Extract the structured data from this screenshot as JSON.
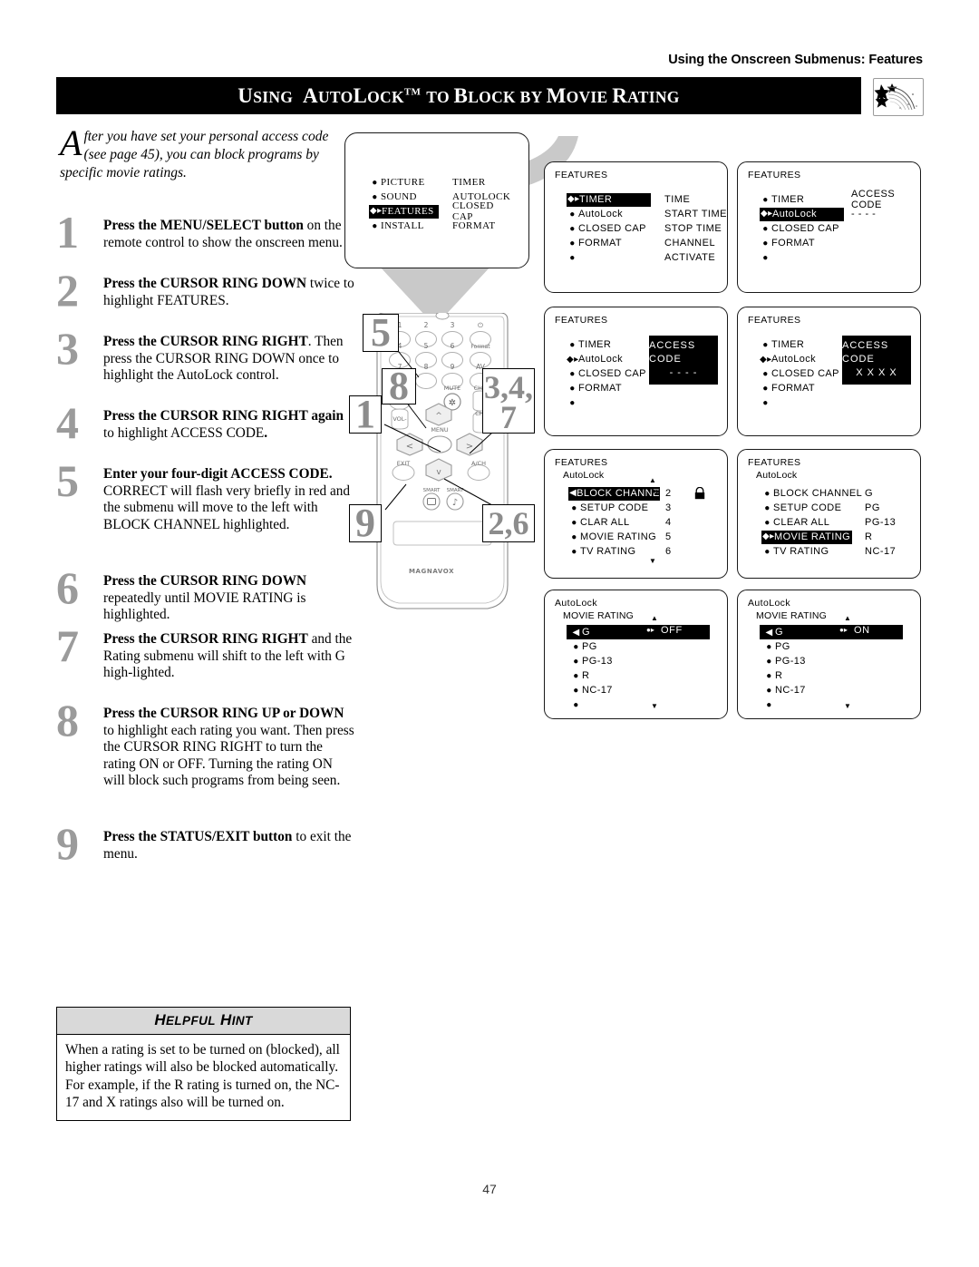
{
  "header": {
    "running_head": "Using the Onscreen Submenus: Features",
    "title_parts": [
      "U",
      "SING",
      "  A",
      "UTO",
      "L",
      "OCK",
      "TM",
      " TO ",
      "B",
      "LOCK BY ",
      "M",
      "OVIE ",
      "R",
      "ATING"
    ],
    "title_plain": "Using AutoLock™ to Block by Movie Rating",
    "logo": "shooting-stars-logo"
  },
  "intro": {
    "dropcap": "A",
    "text": "fter you have set your personal access code (see page 45), you can block programs by specific movie ratings."
  },
  "steps": [
    {
      "num": "1",
      "html": "<b>Press the MENU/SELECT button</b> on the remote control to show the onscreen menu.",
      "plain": "Press the MENU/SELECT button on the remote control to show the onscreen menu."
    },
    {
      "num": "2",
      "html": "<b>Press the CURSOR RING DOWN</b> twice to highlight FEATURES.",
      "plain": "Press the CURSOR RING DOWN twice to highlight FEATURES."
    },
    {
      "num": "3",
      "html": "<b>Press the CURSOR RING RIGHT</b>. Then press the CURSOR RING DOWN once to highlight the AutoLock control.",
      "plain": "Press the CURSOR RING RIGHT. Then press the CURSOR RING DOWN once to highlight the AutoLock control."
    },
    {
      "num": "4",
      "html": "<b>Press the CURSOR RING RIGHT again</b> to highlight ACCESS CODE<b>.</b>",
      "plain": "Press the CURSOR RING RIGHT again to highlight ACCESS CODE."
    },
    {
      "num": "5",
      "html": "<b>Enter your four-digit ACCESS CODE.</b> CORRECT will flash very briefly in red and the submenu will move to the left with BLOCK CHANNEL highlighted.",
      "plain": "Enter your four-digit ACCESS CODE. CORRECT will flash very briefly in red and the submenu will move to the left with BLOCK CHANNEL highlighted."
    },
    {
      "num": "6",
      "html": "<b>Press the CURSOR RING DOWN</b> repeatedly until MOVIE RATING is highlighted.",
      "plain": "Press the CURSOR RING DOWN repeatedly until MOVIE RATING is highlighted."
    },
    {
      "num": "7",
      "html": "<b>Press the CURSOR RING RIGHT</b> and the Rating submenu will shift to the left with G high-lighted.",
      "plain": "Press the CURSOR RING RIGHT and the Rating submenu will shift to the left with G high-lighted."
    },
    {
      "num": "8",
      "html": "<b>Press the CURSOR RING UP or DOWN</b> to highlight each rating you want. Then press the CURSOR RING RIGHT to turn the rating ON or OFF. Turning the rating ON will block such programs from being seen.",
      "plain": "Press the CURSOR RING UP or DOWN to highlight each rating you want. Then press the CURSOR RING RIGHT to turn the rating ON or OFF. Turning the rating ON will block such programs from being seen."
    },
    {
      "num": "9",
      "html": "<b>Press the STATUS/EXIT button</b> to exit the menu.",
      "plain": "Press the STATUS/EXIT button to exit the menu."
    }
  ],
  "hint": {
    "heading": "Helpful Hint",
    "heading_parts": [
      "H",
      "ELPFUL ",
      "H",
      "INT"
    ],
    "body": "When a rating is set to be turned on (blocked), all higher ratings will also be blocked automatically. For example, if the R rating is turned on, the NC-17 and X ratings also will be turned on."
  },
  "tv_screen": {
    "left_items": [
      {
        "label": "PICTURE",
        "highlight": false
      },
      {
        "label": "SOUND",
        "highlight": false
      },
      {
        "label": "FEATURES",
        "highlight": true
      },
      {
        "label": "INSTALL",
        "highlight": false
      }
    ],
    "right_items": [
      "TIMER",
      "AUTOLOCK",
      "CLOSED CAP",
      "FORMAT"
    ]
  },
  "panels": [
    {
      "id": "features-timer",
      "title": "FEATURES",
      "subtitle": "",
      "left_items": [
        {
          "label": "TIMER",
          "highlight": true
        },
        {
          "label": "AutoLock",
          "highlight": false
        },
        {
          "label": "CLOSED CAP",
          "highlight": false
        },
        {
          "label": "FORMAT",
          "highlight": false
        },
        {
          "label": "",
          "highlight": false
        }
      ],
      "right_items": [
        "TIME",
        "START TIME",
        "STOP TIME",
        "CHANNEL",
        "ACTIVATE"
      ],
      "right_boxed": false
    },
    {
      "id": "features-autolock",
      "title": "FEATURES",
      "subtitle": "",
      "left_items": [
        {
          "label": "TIMER",
          "highlight": false
        },
        {
          "label": "AutoLock",
          "highlight": true
        },
        {
          "label": "CLOSED CAP",
          "highlight": false
        },
        {
          "label": "FORMAT",
          "highlight": false
        },
        {
          "label": "",
          "highlight": false
        }
      ],
      "right_items": [
        "ACCESS CODE",
        "- - - -"
      ],
      "right_boxed": false
    },
    {
      "id": "features-access-code-empty",
      "title": "FEATURES",
      "subtitle": "",
      "left_items": [
        {
          "label": "TIMER",
          "highlight": false
        },
        {
          "label": "AutoLock",
          "highlight": false,
          "nav": true
        },
        {
          "label": "CLOSED CAP",
          "highlight": false
        },
        {
          "label": "FORMAT",
          "highlight": false
        },
        {
          "label": "",
          "highlight": false
        }
      ],
      "right_items": [
        "ACCESS CODE",
        "- - - -"
      ],
      "right_boxed": true
    },
    {
      "id": "features-access-code-filled",
      "title": "FEATURES",
      "subtitle": "",
      "left_items": [
        {
          "label": "TIMER",
          "highlight": false
        },
        {
          "label": "AutoLock",
          "highlight": false,
          "nav": true
        },
        {
          "label": "CLOSED CAP",
          "highlight": false
        },
        {
          "label": "FORMAT",
          "highlight": false
        },
        {
          "label": "",
          "highlight": false
        }
      ],
      "right_items": [
        "ACCESS CODE",
        "X X X X"
      ],
      "right_boxed": true
    },
    {
      "id": "autolock-block-channel",
      "title": "FEATURES",
      "subtitle": "AutoLock",
      "left_items": [
        {
          "label": "BLOCK CHANNEL",
          "highlight": true
        },
        {
          "label": "SETUP CODE",
          "highlight": false
        },
        {
          "label": "CLAR ALL",
          "highlight": false
        },
        {
          "label": "MOVIE RATING",
          "highlight": false
        },
        {
          "label": "TV RATING",
          "highlight": false
        }
      ],
      "right_items": [
        "2",
        "3",
        "4",
        "5",
        "6"
      ],
      "lock_icon": "padlock-icon",
      "scroll_up": true,
      "scroll_down": true
    },
    {
      "id": "autolock-movie-rating",
      "title": "FEATURES",
      "subtitle": "AutoLock",
      "left_items": [
        {
          "label": "BLOCK CHANNEL",
          "highlight": false
        },
        {
          "label": "SETUP CODE",
          "highlight": false
        },
        {
          "label": "CLEAR ALL",
          "highlight": false
        },
        {
          "label": "MOVIE RATING",
          "highlight": true
        },
        {
          "label": "TV RATING",
          "highlight": false
        }
      ],
      "right_items": [
        "G",
        "PG",
        "PG-13",
        "R",
        "NC-17"
      ]
    },
    {
      "id": "movie-rating-off",
      "title": "AutoLock",
      "subtitle": "MOVIE RATING",
      "left_items": [
        {
          "label": "G",
          "highlight": true
        },
        {
          "label": "PG",
          "highlight": false
        },
        {
          "label": "PG-13",
          "highlight": false
        },
        {
          "label": "R",
          "highlight": false
        },
        {
          "label": "NC-17",
          "highlight": false
        },
        {
          "label": "",
          "highlight": false
        }
      ],
      "value": "OFF",
      "scroll_up": true,
      "scroll_down": true
    },
    {
      "id": "movie-rating-on",
      "title": "AutoLock",
      "subtitle": "MOVIE RATING",
      "left_items": [
        {
          "label": "G",
          "highlight": true
        },
        {
          "label": "PG",
          "highlight": false
        },
        {
          "label": "PG-13",
          "highlight": false
        },
        {
          "label": "R",
          "highlight": false
        },
        {
          "label": "NC-17",
          "highlight": false
        },
        {
          "label": "",
          "highlight": false
        }
      ],
      "value": "ON",
      "scroll_up": true,
      "scroll_down": true
    }
  ],
  "remote": {
    "brand": "MAGNAVOX",
    "keys_row1": [
      "1",
      "2",
      "3",
      "⏻"
    ],
    "keys_row2": [
      "5",
      "6",
      "Format"
    ],
    "keys_row3": [
      "8",
      "9",
      "AV"
    ],
    "keys_row4": [
      "0",
      "MUTE",
      "CH+"
    ],
    "label_vol": "VOL-",
    "label_chdown": "CH-",
    "label_menu": "MENU",
    "label_exit": "EXIT",
    "label_ach": "A/CH",
    "label_smart_picture": "SMART",
    "label_smart_sound": "SMART",
    "callouts": [
      {
        "id": "callout-5",
        "text": "5"
      },
      {
        "id": "callout-8",
        "text": "8"
      },
      {
        "id": "callout-1",
        "text": "1"
      },
      {
        "id": "callout-347",
        "text": "3,4,\n7"
      },
      {
        "id": "callout-9",
        "text": "9"
      },
      {
        "id": "callout-26",
        "text": "2,6"
      }
    ]
  },
  "footer": {
    "page_number": "47"
  },
  "colors": {
    "ink": "#000000",
    "step_number_gray": "#9b9b9b",
    "hint_header_gray": "#d9d9d9",
    "beam_gray": "#c9c9c9"
  }
}
